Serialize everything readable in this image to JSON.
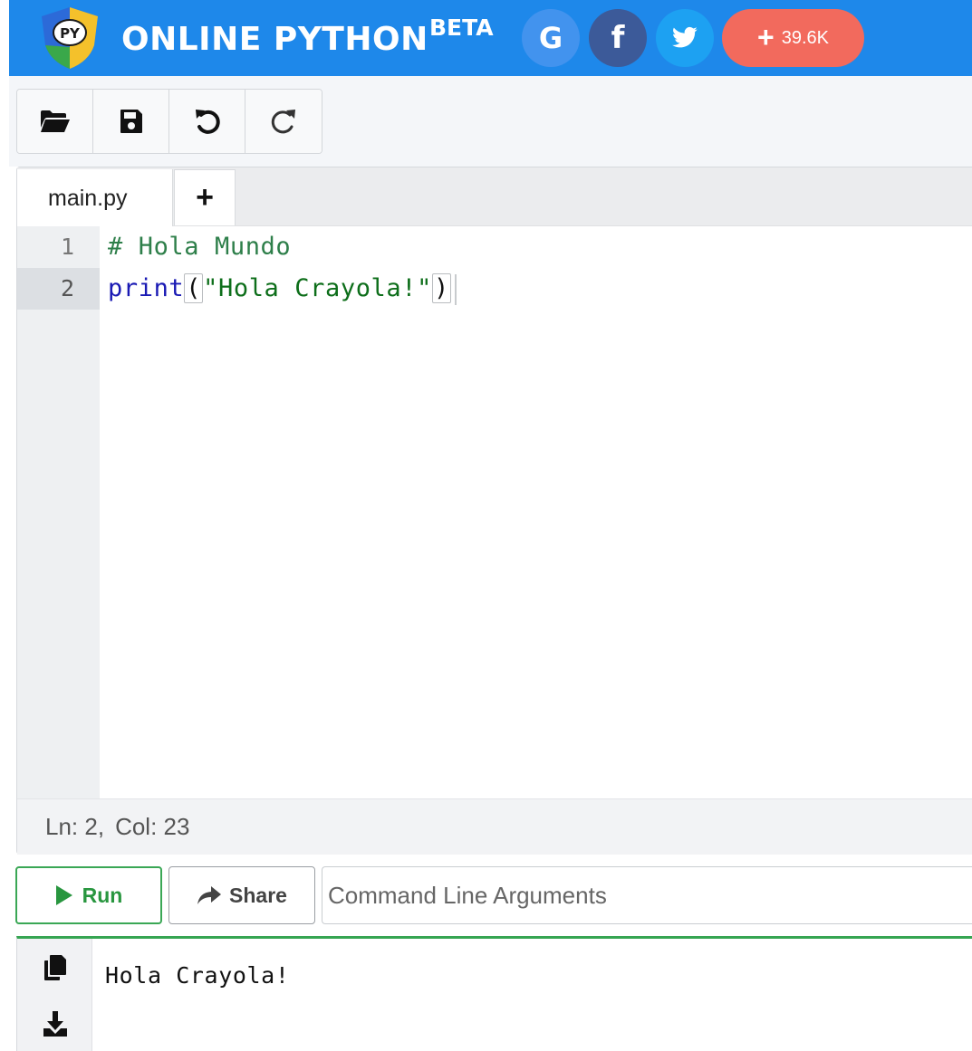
{
  "header": {
    "logo_text": "PY",
    "title": "ONLINE PYTHON",
    "badge": "BETA",
    "social": [
      {
        "name": "google-share",
        "glyph": "G",
        "icon": "google-icon"
      },
      {
        "name": "facebook-share",
        "glyph": "f",
        "icon": "facebook-icon"
      },
      {
        "name": "twitter-share",
        "icon": "twitter-icon"
      }
    ],
    "share_count_plus": "+",
    "share_count": "39.6K",
    "colors": {
      "header": "#1e88ea",
      "plus_pill": "#f26a5d"
    }
  },
  "toolbar": {
    "items": [
      "open-folder-icon",
      "save-icon",
      "undo-icon",
      "redo-icon"
    ]
  },
  "editor": {
    "tabs": [
      {
        "label": "main.py",
        "active": true
      }
    ],
    "add_tab_label": "+",
    "line_numbers": [
      "1",
      "2"
    ],
    "active_line": 2,
    "code": {
      "line1_comment": "# Hola Mundo",
      "line2_keyword": "print",
      "line2_open": "(",
      "line2_string": "\"Hola Crayola!\"",
      "line2_close": ")"
    },
    "status": {
      "line": "Ln: 2,",
      "col": "Col: 23"
    }
  },
  "actions": {
    "run_label": "Run",
    "share_label": "Share",
    "args_placeholder": "Command Line Arguments",
    "colors": {
      "run": "#28963f"
    }
  },
  "output": {
    "text": "Hola Crayola!",
    "side_icons": [
      "copy-icon",
      "download-icon"
    ]
  }
}
